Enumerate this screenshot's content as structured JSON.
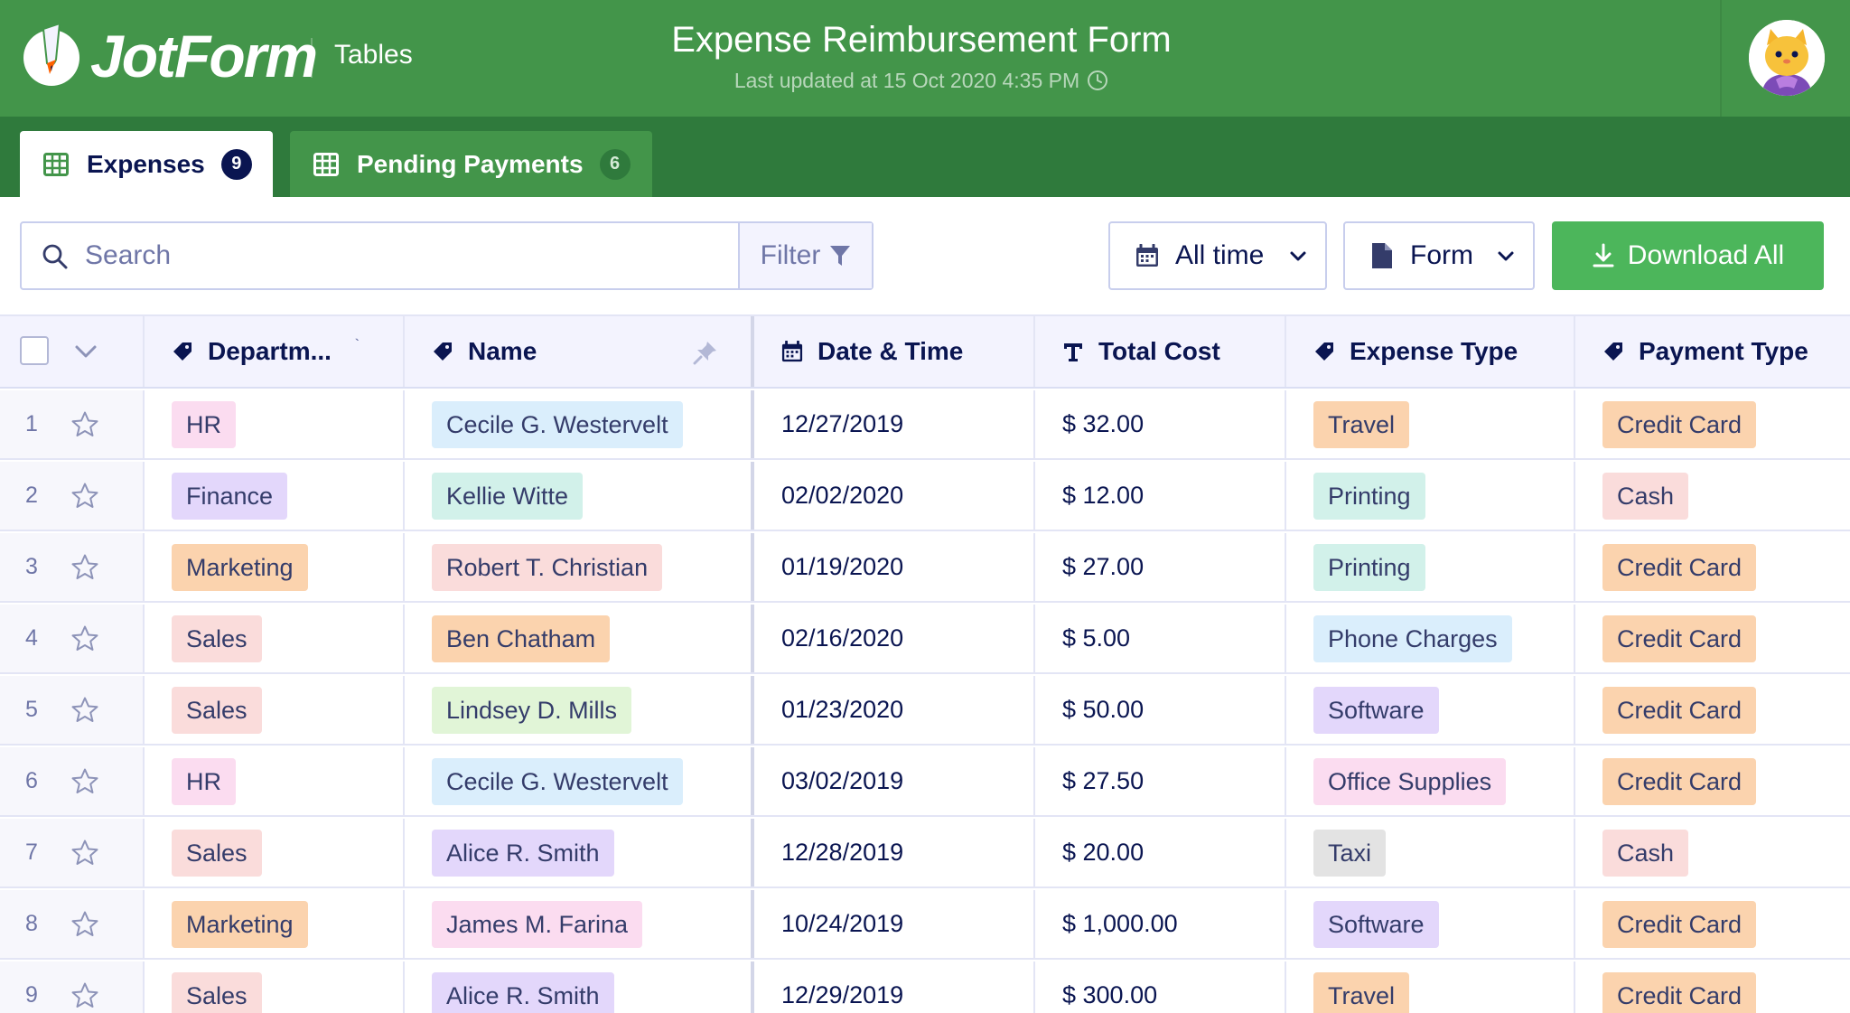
{
  "app": {
    "brand": "JotForm",
    "product": "Tables",
    "title": "Expense Reimbursement Form",
    "last_updated": "Last updated at 15 Oct 2020 4:35 PM"
  },
  "tabs": [
    {
      "label": "Expenses",
      "count": "9",
      "active": true
    },
    {
      "label": "Pending Payments",
      "count": "6",
      "active": false
    }
  ],
  "toolbar": {
    "search_placeholder": "Search",
    "filter_label": "Filter",
    "time_label": "All time",
    "form_label": "Form",
    "download_label": "Download All"
  },
  "columns": [
    {
      "label": "Departm...",
      "icon": "tag-icon"
    },
    {
      "label": "Name",
      "icon": "tag-icon"
    },
    {
      "label": "Date & Time",
      "icon": "calendar-icon"
    },
    {
      "label": "Total Cost",
      "icon": "text-icon"
    },
    {
      "label": "Expense Type",
      "icon": "tag-icon"
    },
    {
      "label": "Payment Type",
      "icon": "tag-icon"
    }
  ],
  "rows": [
    {
      "num": "1",
      "department": "HR",
      "name": "Cecile G. Westervelt",
      "date": "12/27/2019",
      "cost": "$ 32.00",
      "expense_type": "Travel",
      "payment_type": "Credit Card"
    },
    {
      "num": "2",
      "department": "Finance",
      "name": "Kellie Witte",
      "date": "02/02/2020",
      "cost": "$ 12.00",
      "expense_type": "Printing",
      "payment_type": "Cash"
    },
    {
      "num": "3",
      "department": "Marketing",
      "name": "Robert T. Christian",
      "date": "01/19/2020",
      "cost": "$ 27.00",
      "expense_type": "Printing",
      "payment_type": "Credit Card"
    },
    {
      "num": "4",
      "department": "Sales",
      "name": "Ben Chatham",
      "date": "02/16/2020",
      "cost": "$ 5.00",
      "expense_type": "Phone Charges",
      "payment_type": "Credit Card"
    },
    {
      "num": "5",
      "department": "Sales",
      "name": "Lindsey D. Mills",
      "date": "01/23/2020",
      "cost": "$ 50.00",
      "expense_type": "Software",
      "payment_type": "Credit Card"
    },
    {
      "num": "6",
      "department": "HR",
      "name": "Cecile G. Westervelt",
      "date": "03/02/2019",
      "cost": "$ 27.50",
      "expense_type": "Office Supplies",
      "payment_type": "Credit Card"
    },
    {
      "num": "7",
      "department": "Sales",
      "name": "Alice R. Smith",
      "date": "12/28/2019",
      "cost": "$ 20.00",
      "expense_type": "Taxi",
      "payment_type": "Cash"
    },
    {
      "num": "8",
      "department": "Marketing",
      "name": "James M. Farina",
      "date": "10/24/2019",
      "cost": "$ 1,000.00",
      "expense_type": "Software",
      "payment_type": "Credit Card"
    },
    {
      "num": "9",
      "department": "Sales",
      "name": "Alice R. Smith",
      "date": "12/29/2019",
      "cost": "$ 300.00",
      "expense_type": "Travel",
      "payment_type": "Credit Card"
    }
  ],
  "tag_colors": {
    "HR": "#fbdcf0",
    "Finance": "#e3d7fb",
    "Marketing": "#fbd3ae",
    "Sales": "#fadcdb",
    "Cecile G. Westervelt": "#daeefc",
    "Kellie Witte": "#d2f1ea",
    "Robert T. Christian": "#fadcdb",
    "Ben Chatham": "#fbd3ae",
    "Lindsey D. Mills": "#e1f5d7",
    "Alice R. Smith": "#e3d7fb",
    "James M. Farina": "#fbdcf0",
    "Travel": "#fbd3ae",
    "Printing": "#d2f1ea",
    "Phone Charges": "#daeefc",
    "Software": "#e3d7fb",
    "Office Supplies": "#fbdcf0",
    "Taxi": "#e3e3e3",
    "Credit Card": "#fbd3ae",
    "Cash": "#fadcdb"
  },
  "colors": {
    "header_green": "#43954a",
    "tab_bar_green": "#2f7a3c",
    "download_green": "#4cb65b",
    "navy": "#0a1551"
  }
}
